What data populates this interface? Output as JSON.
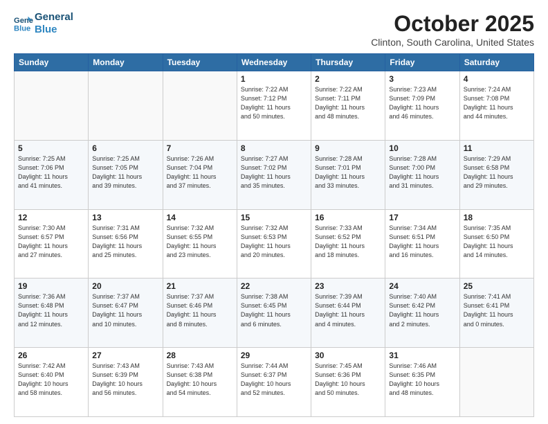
{
  "logo": {
    "line1": "General",
    "line2": "Blue"
  },
  "header": {
    "title": "October 2025",
    "subtitle": "Clinton, South Carolina, United States"
  },
  "days_of_week": [
    "Sunday",
    "Monday",
    "Tuesday",
    "Wednesday",
    "Thursday",
    "Friday",
    "Saturday"
  ],
  "weeks": [
    [
      {
        "day": "",
        "info": ""
      },
      {
        "day": "",
        "info": ""
      },
      {
        "day": "",
        "info": ""
      },
      {
        "day": "1",
        "info": "Sunrise: 7:22 AM\nSunset: 7:12 PM\nDaylight: 11 hours\nand 50 minutes."
      },
      {
        "day": "2",
        "info": "Sunrise: 7:22 AM\nSunset: 7:11 PM\nDaylight: 11 hours\nand 48 minutes."
      },
      {
        "day": "3",
        "info": "Sunrise: 7:23 AM\nSunset: 7:09 PM\nDaylight: 11 hours\nand 46 minutes."
      },
      {
        "day": "4",
        "info": "Sunrise: 7:24 AM\nSunset: 7:08 PM\nDaylight: 11 hours\nand 44 minutes."
      }
    ],
    [
      {
        "day": "5",
        "info": "Sunrise: 7:25 AM\nSunset: 7:06 PM\nDaylight: 11 hours\nand 41 minutes."
      },
      {
        "day": "6",
        "info": "Sunrise: 7:25 AM\nSunset: 7:05 PM\nDaylight: 11 hours\nand 39 minutes."
      },
      {
        "day": "7",
        "info": "Sunrise: 7:26 AM\nSunset: 7:04 PM\nDaylight: 11 hours\nand 37 minutes."
      },
      {
        "day": "8",
        "info": "Sunrise: 7:27 AM\nSunset: 7:02 PM\nDaylight: 11 hours\nand 35 minutes."
      },
      {
        "day": "9",
        "info": "Sunrise: 7:28 AM\nSunset: 7:01 PM\nDaylight: 11 hours\nand 33 minutes."
      },
      {
        "day": "10",
        "info": "Sunrise: 7:28 AM\nSunset: 7:00 PM\nDaylight: 11 hours\nand 31 minutes."
      },
      {
        "day": "11",
        "info": "Sunrise: 7:29 AM\nSunset: 6:58 PM\nDaylight: 11 hours\nand 29 minutes."
      }
    ],
    [
      {
        "day": "12",
        "info": "Sunrise: 7:30 AM\nSunset: 6:57 PM\nDaylight: 11 hours\nand 27 minutes."
      },
      {
        "day": "13",
        "info": "Sunrise: 7:31 AM\nSunset: 6:56 PM\nDaylight: 11 hours\nand 25 minutes."
      },
      {
        "day": "14",
        "info": "Sunrise: 7:32 AM\nSunset: 6:55 PM\nDaylight: 11 hours\nand 23 minutes."
      },
      {
        "day": "15",
        "info": "Sunrise: 7:32 AM\nSunset: 6:53 PM\nDaylight: 11 hours\nand 20 minutes."
      },
      {
        "day": "16",
        "info": "Sunrise: 7:33 AM\nSunset: 6:52 PM\nDaylight: 11 hours\nand 18 minutes."
      },
      {
        "day": "17",
        "info": "Sunrise: 7:34 AM\nSunset: 6:51 PM\nDaylight: 11 hours\nand 16 minutes."
      },
      {
        "day": "18",
        "info": "Sunrise: 7:35 AM\nSunset: 6:50 PM\nDaylight: 11 hours\nand 14 minutes."
      }
    ],
    [
      {
        "day": "19",
        "info": "Sunrise: 7:36 AM\nSunset: 6:48 PM\nDaylight: 11 hours\nand 12 minutes."
      },
      {
        "day": "20",
        "info": "Sunrise: 7:37 AM\nSunset: 6:47 PM\nDaylight: 11 hours\nand 10 minutes."
      },
      {
        "day": "21",
        "info": "Sunrise: 7:37 AM\nSunset: 6:46 PM\nDaylight: 11 hours\nand 8 minutes."
      },
      {
        "day": "22",
        "info": "Sunrise: 7:38 AM\nSunset: 6:45 PM\nDaylight: 11 hours\nand 6 minutes."
      },
      {
        "day": "23",
        "info": "Sunrise: 7:39 AM\nSunset: 6:44 PM\nDaylight: 11 hours\nand 4 minutes."
      },
      {
        "day": "24",
        "info": "Sunrise: 7:40 AM\nSunset: 6:42 PM\nDaylight: 11 hours\nand 2 minutes."
      },
      {
        "day": "25",
        "info": "Sunrise: 7:41 AM\nSunset: 6:41 PM\nDaylight: 11 hours\nand 0 minutes."
      }
    ],
    [
      {
        "day": "26",
        "info": "Sunrise: 7:42 AM\nSunset: 6:40 PM\nDaylight: 10 hours\nand 58 minutes."
      },
      {
        "day": "27",
        "info": "Sunrise: 7:43 AM\nSunset: 6:39 PM\nDaylight: 10 hours\nand 56 minutes."
      },
      {
        "day": "28",
        "info": "Sunrise: 7:43 AM\nSunset: 6:38 PM\nDaylight: 10 hours\nand 54 minutes."
      },
      {
        "day": "29",
        "info": "Sunrise: 7:44 AM\nSunset: 6:37 PM\nDaylight: 10 hours\nand 52 minutes."
      },
      {
        "day": "30",
        "info": "Sunrise: 7:45 AM\nSunset: 6:36 PM\nDaylight: 10 hours\nand 50 minutes."
      },
      {
        "day": "31",
        "info": "Sunrise: 7:46 AM\nSunset: 6:35 PM\nDaylight: 10 hours\nand 48 minutes."
      },
      {
        "day": "",
        "info": ""
      }
    ]
  ]
}
